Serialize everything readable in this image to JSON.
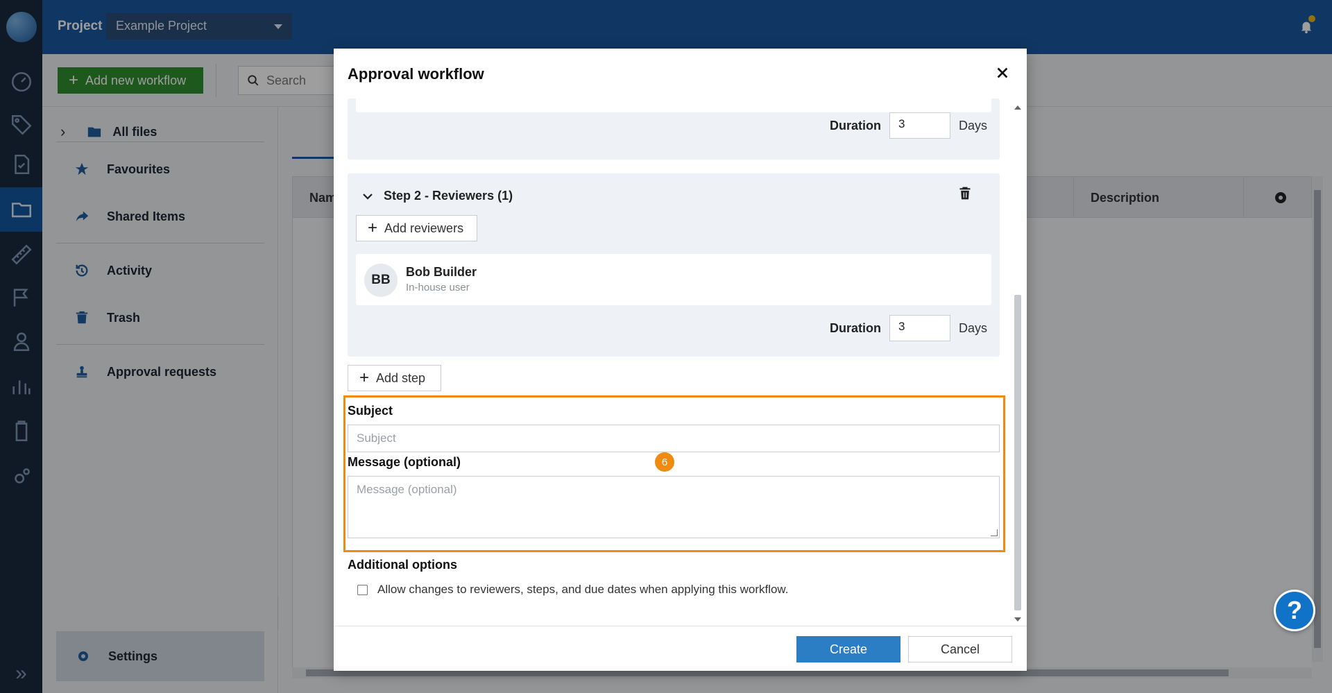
{
  "header": {
    "project_label": "Project",
    "project_name": "Example Project",
    "accent": "#1a5aa0",
    "notification_icon": "bell-icon"
  },
  "toolbar": {
    "add_workflow_label": "Add new workflow",
    "search_placeholder": "Search"
  },
  "sidebar": {
    "items": [
      {
        "label": "All files",
        "icon": "folder-icon"
      },
      {
        "label": "Favourites",
        "icon": "star-icon"
      },
      {
        "label": "Shared Items",
        "icon": "share-icon"
      },
      {
        "label": "Activity",
        "icon": "history-icon"
      },
      {
        "label": "Trash",
        "icon": "trash-icon"
      },
      {
        "label": "Approval requests",
        "icon": "stamp-icon"
      }
    ],
    "settings_label": "Settings"
  },
  "table": {
    "col_name": "Nam",
    "col_description": "Description"
  },
  "modal": {
    "title": "Approval workflow",
    "step1": {
      "duration_label": "Duration",
      "duration_value": "3",
      "duration_unit": "Days"
    },
    "step2": {
      "title": "Step 2 - Reviewers (1)",
      "add_reviewers_label": "Add reviewers",
      "reviewer": {
        "initials": "BB",
        "name": "Bob Builder",
        "type": "In-house user"
      },
      "duration_label": "Duration",
      "duration_value": "3",
      "duration_unit": "Days"
    },
    "add_step_label": "Add step",
    "subject_label": "Subject",
    "subject_placeholder": "Subject",
    "message_label": "Message (optional)",
    "message_placeholder": "Message (optional)",
    "callout_number": "6",
    "additional_options_label": "Additional options",
    "allow_changes_label": "Allow changes to reviewers, steps, and due dates when applying this workflow.",
    "allow_changes_checked": false,
    "create_label": "Create",
    "cancel_label": "Cancel"
  },
  "help_label": "?"
}
